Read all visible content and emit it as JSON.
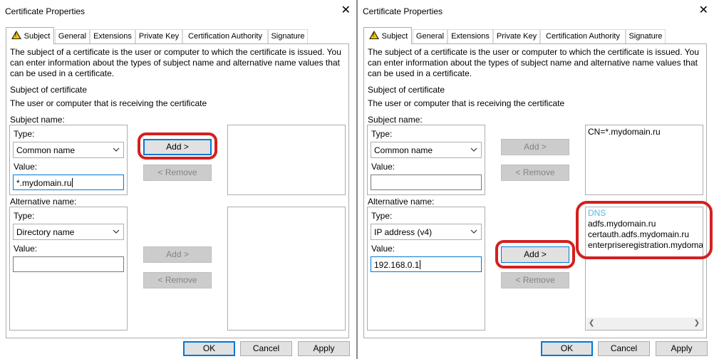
{
  "window": {
    "title": "Certificate Properties",
    "close_glyph": "✕"
  },
  "tabs": [
    "Subject",
    "General",
    "Extensions",
    "Private Key",
    "Certification Authority",
    "Signature"
  ],
  "description": "The subject of a certificate is the user or computer to which the certificate is issued. You can enter information about the types of subject name and alternative name values that can be used in a certificate.",
  "subject_heading": "Subject of certificate",
  "subject_sub": "The user or computer that is receiving the certificate",
  "subject_name_label": "Subject name:",
  "alt_name_label": "Alternative name:",
  "type_label": "Type:",
  "value_label": "Value:",
  "add_label": "Add >",
  "remove_label": "< Remove",
  "footer": {
    "ok": "OK",
    "cancel": "Cancel",
    "apply": "Apply"
  },
  "left": {
    "subject_type": "Common name",
    "subject_value": "*.mydomain.ru",
    "alt_type": "Directory name",
    "alt_value": ""
  },
  "right": {
    "subject_type": "Common name",
    "subject_value": "",
    "subject_list": [
      "CN=*.mydomain.ru"
    ],
    "alt_type": "IP address (v4)",
    "alt_value": "192.168.0.1",
    "alt_list_header": "DNS",
    "alt_list": [
      "adfs.mydomain.ru",
      "certauth.adfs.mydomain.ru",
      "enterpriseregistration.mydoma"
    ]
  },
  "colors": {
    "highlight": "#d4201f",
    "focus": "#0078d7",
    "dns_header": "#5ab4e6"
  },
  "icons": {
    "tab_warning": "warning-icon",
    "dropdown": "chevron-down-icon",
    "close": "close-icon"
  }
}
